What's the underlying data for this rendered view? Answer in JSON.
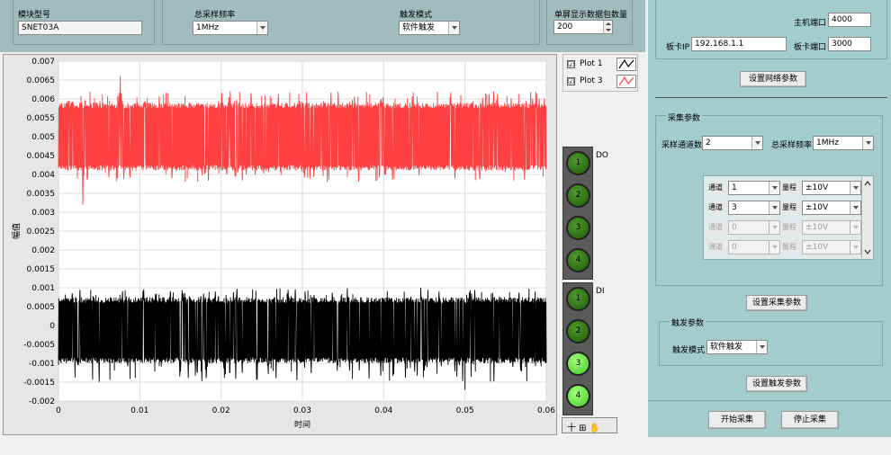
{
  "top": {
    "module_model": {
      "label": "模块型号",
      "value": "SNET03A"
    },
    "total_rate": {
      "label": "总采样频率",
      "value": "1MHz"
    },
    "trigger_mode": {
      "label": "触发模式",
      "value": "软件触发"
    },
    "packets": {
      "label": "单屏显示数据包数量",
      "value": "200"
    }
  },
  "graph": {
    "ylabel": "幅值",
    "xlabel": "时间",
    "legend": [
      {
        "name": "Plot 1",
        "color": "#000000",
        "checked": "☑"
      },
      {
        "name": "Plot 3",
        "color": "#ff4040",
        "checked": "☑"
      }
    ],
    "tools_text": "十 ⊞ ✋"
  },
  "chart_data": {
    "type": "line",
    "xlim": [
      0,
      0.06
    ],
    "ylim": [
      -0.002,
      0.007
    ],
    "xticks": [
      "0",
      "0.01",
      "0.02",
      "0.03",
      "0.04",
      "0.05",
      "0.06"
    ],
    "yticks": [
      "0.007",
      "0.0065",
      "0.006",
      "0.0055",
      "0.005",
      "0.0045",
      "0.004",
      "0.0035",
      "0.003",
      "0.0025",
      "0.002",
      "0.0015",
      "0.001",
      "0.0005",
      "0",
      "-0.0005",
      "-0.001",
      "-0.0015",
      "-0.002"
    ],
    "grid": true,
    "series": [
      {
        "name": "Plot 1",
        "color": "#000000",
        "band": [
          -0.001,
          0.00075
        ],
        "spikes": [
          -0.0015,
          0.001
        ],
        "min_spike": -0.0017
      },
      {
        "name": "Plot 3",
        "color": "#ff4040",
        "band": [
          0.0041,
          0.0059
        ],
        "spikes": [
          0.0038,
          0.0062
        ],
        "max_spike": 0.0066,
        "min_spike": 0.0032
      }
    ]
  },
  "leds": {
    "do_label": "DO",
    "di_label": "DI",
    "do": [
      {
        "n": "1",
        "state": "off"
      },
      {
        "n": "2",
        "state": "off"
      },
      {
        "n": "3",
        "state": "off"
      },
      {
        "n": "4",
        "state": "off"
      }
    ],
    "di": [
      {
        "n": "1",
        "state": "off"
      },
      {
        "n": "2",
        "state": "off"
      },
      {
        "n": "3",
        "state": "on"
      },
      {
        "n": "4",
        "state": "on"
      }
    ]
  },
  "network": {
    "host_port": {
      "label": "主机端口",
      "value": "4000"
    },
    "card_ip": {
      "label": "板卡IP",
      "value": "192.168.1.1"
    },
    "card_port": {
      "label": "板卡端口",
      "value": "3000"
    },
    "set_button": "设置网络参数"
  },
  "acq": {
    "title": "采集参数",
    "channel_count": {
      "label": "采样通道数",
      "value": "2"
    },
    "total_rate": {
      "label": "总采样频率",
      "value": "1MHz"
    },
    "channels": [
      {
        "tag": "通道",
        "ch": "1",
        "range_tag": "量程",
        "range": "±10V",
        "enabled": true
      },
      {
        "tag": "通道",
        "ch": "3",
        "range_tag": "量程",
        "range": "±10V",
        "enabled": true
      },
      {
        "tag": "通道",
        "ch": "0",
        "range_tag": "量程",
        "range": "±10V",
        "enabled": false
      },
      {
        "tag": "通道",
        "ch": "0",
        "range_tag": "量程",
        "range": "±10V",
        "enabled": false
      }
    ],
    "set_button": "设置采集参数"
  },
  "trigger": {
    "title": "触发参数",
    "mode": {
      "label": "触发模式",
      "value": "软件触发"
    },
    "set_button": "设置触发参数"
  },
  "controls": {
    "start": "开始采集",
    "stop": "停止采集"
  }
}
